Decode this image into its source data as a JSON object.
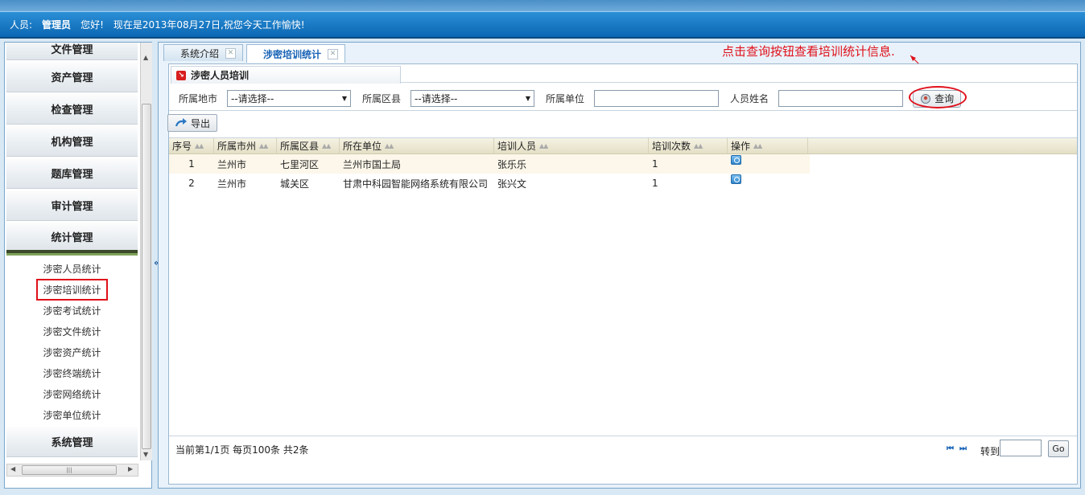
{
  "header": {
    "person_label": "人员:",
    "user": "管理员",
    "greeting": "您好!",
    "date_text": "现在是2013年08月27日,祝您今天工作愉快!"
  },
  "sidebar": {
    "groups": [
      {
        "label": "文件管理"
      },
      {
        "label": "资产管理"
      },
      {
        "label": "检查管理"
      },
      {
        "label": "机构管理"
      },
      {
        "label": "题库管理"
      },
      {
        "label": "审计管理"
      },
      {
        "label": "统计管理"
      }
    ],
    "sub_items": [
      {
        "label": "涉密人员统计"
      },
      {
        "label": "涉密培训统计"
      },
      {
        "label": "涉密考试统计"
      },
      {
        "label": "涉密文件统计"
      },
      {
        "label": "涉密资产统计"
      },
      {
        "label": "涉密终端统计"
      },
      {
        "label": "涉密网络统计"
      },
      {
        "label": "涉密单位统计"
      }
    ],
    "last_group": "系统管理",
    "selected_item": "涉密培训统计",
    "collapse_glyph": "«"
  },
  "tabs": [
    {
      "label": "系统介绍",
      "active": false
    },
    {
      "label": "涉密培训统计",
      "active": true
    }
  ],
  "annotation": "点击查询按钮查看培训统计信息.",
  "panel": {
    "title": "涉密人员培训"
  },
  "filters": {
    "city_label": "所属地市",
    "city_value": "--请选择--",
    "district_label": "所属区县",
    "district_value": "--请选择--",
    "unit_label": "所属单位",
    "name_label": "人员姓名",
    "query_label": "查询"
  },
  "toolbar": {
    "export_label": "导出"
  },
  "grid": {
    "columns": [
      "序号",
      "所属市州",
      "所属区县",
      "所在单位",
      "培训人员",
      "培训次数",
      "操作"
    ],
    "rows": [
      {
        "no": "1",
        "city": "兰州市",
        "district": "七里河区",
        "unit": "兰州市国土局",
        "person": "张乐乐",
        "count": "1"
      },
      {
        "no": "2",
        "city": "兰州市",
        "district": "城关区",
        "unit": "甘肃中科园智能网络系统有限公司",
        "person": "张兴文",
        "count": "1"
      }
    ]
  },
  "pager": {
    "info": "当前第1/1页 每页100条 共2条",
    "goto_label": "转到",
    "go_button": "Go"
  },
  "colors": {
    "header_blue": "#0b66b3",
    "accent_red": "#e0101a",
    "link_blue": "#1762b5"
  }
}
